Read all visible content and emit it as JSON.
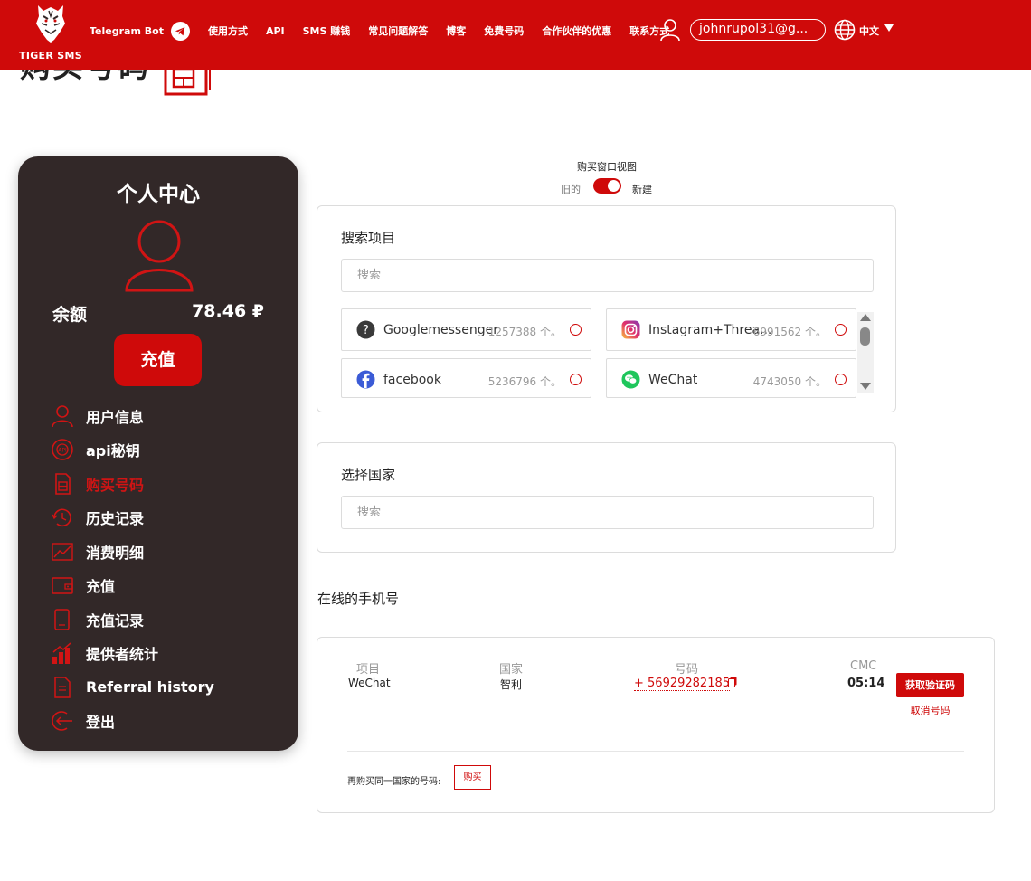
{
  "header": {
    "logo_text": "TIGER SMS",
    "nav": [
      {
        "label": "Telegram Bot"
      },
      {
        "label": "使用方式"
      },
      {
        "label": "API"
      },
      {
        "label": "SMS 赚钱"
      },
      {
        "label": "常见问题解答"
      },
      {
        "label": "博客"
      },
      {
        "label": "免费号码"
      },
      {
        "label": "合作伙伴的优惠"
      },
      {
        "label": "联系方式"
      }
    ],
    "email": "johnrupol31@g...",
    "language": "中文"
  },
  "page_title": "购买号码",
  "sidebar": {
    "title": "个人中心",
    "balance_label": "余额",
    "balance_value": "78.46 ₽",
    "topup_label": "充值",
    "menu": [
      {
        "label": "用户信息",
        "icon": "user-icon"
      },
      {
        "label": "api秘钥",
        "icon": "api-icon"
      },
      {
        "label": "购买号码",
        "icon": "sim-card-icon",
        "active": true
      },
      {
        "label": "历史记录",
        "icon": "history-icon"
      },
      {
        "label": "消费明细",
        "icon": "chart-line-icon"
      },
      {
        "label": "充值",
        "icon": "wallet-icon"
      },
      {
        "label": "充值记录",
        "icon": "receipt-icon"
      },
      {
        "label": "提供者统计",
        "icon": "bar-chart-icon"
      },
      {
        "label": "Referral history",
        "icon": "document-icon"
      },
      {
        "label": "登出",
        "icon": "logout-icon"
      }
    ]
  },
  "view_toggle": {
    "label": "购买窗口视图",
    "old": "旧的",
    "new": "新建",
    "state": "new"
  },
  "services_card": {
    "title": "搜索项目",
    "search_placeholder": "搜索",
    "items": [
      {
        "name": "Googlemessenger",
        "count": "1257388 个。",
        "icon": "question-icon"
      },
      {
        "name": "Instagram+Threa...",
        "count": "6991562 个。",
        "icon": "instagram-icon"
      },
      {
        "name": "facebook",
        "count": "5236796 个。",
        "icon": "facebook-icon"
      },
      {
        "name": "WeChat",
        "count": "4743050 个。",
        "icon": "wechat-icon"
      }
    ]
  },
  "country_card": {
    "title": "选择国家",
    "search_placeholder": "搜索"
  },
  "online_numbers": {
    "title": "在线的手机号",
    "columns": [
      "项目",
      "国家",
      "号码",
      "CMC"
    ],
    "row": {
      "service": "WeChat",
      "country": "智利",
      "number": "+ 56929282185",
      "timer": "05:14",
      "get_code_label": "获取验证码",
      "cancel_label": "取消号码"
    },
    "rebuy_label": "再购买同一国家的号码:",
    "rebuy_button": "购买"
  },
  "colors": {
    "brand_red": "#cf0a0a",
    "sidebar_bg": "#322828"
  }
}
